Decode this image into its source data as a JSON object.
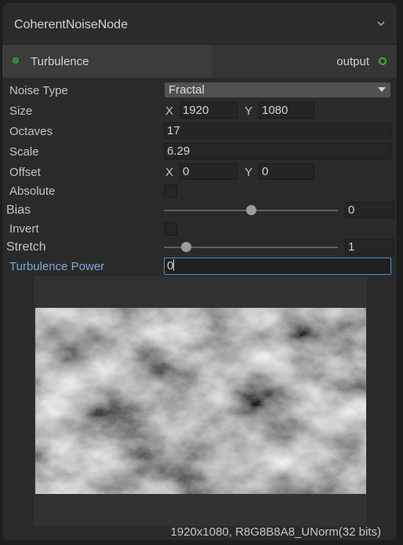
{
  "node": {
    "title": "CoherentNoiseNode",
    "collapse_icon": "chevron-down-icon",
    "input_port_label": "Turbulence",
    "output_port_label": "output"
  },
  "fields": {
    "noise_type": {
      "label": "Noise Type",
      "value": "Fractal",
      "icon": "dropdown-arrow-icon"
    },
    "size": {
      "label": "Size",
      "x_axis": "X",
      "x_value": "1920",
      "y_axis": "Y",
      "y_value": "1080"
    },
    "octaves": {
      "label": "Octaves",
      "value": "17"
    },
    "scale": {
      "label": "Scale",
      "value": "6.29"
    },
    "offset": {
      "label": "Offset",
      "x_axis": "X",
      "x_value": "0",
      "y_axis": "Y",
      "y_value": "0"
    },
    "absolute": {
      "label": "Absolute",
      "checked": false
    },
    "bias": {
      "label": "Bias",
      "value": "0",
      "slider_fraction": 0.5
    },
    "invert": {
      "label": "Invert",
      "checked": false
    },
    "stretch": {
      "label": "Stretch",
      "value": "1",
      "slider_fraction": 0.13
    },
    "turbulence_power": {
      "label": "Turbulence Power",
      "value": "0"
    }
  },
  "preview": {
    "info": "1920x1080, R8G8B8A8_UNorm(32 bits)"
  },
  "colors": {
    "input_port": "#3a7d3a",
    "output_port": "#3ab03a",
    "focused_label": "#7fa8d8",
    "focus_border": "#4d90d4"
  }
}
